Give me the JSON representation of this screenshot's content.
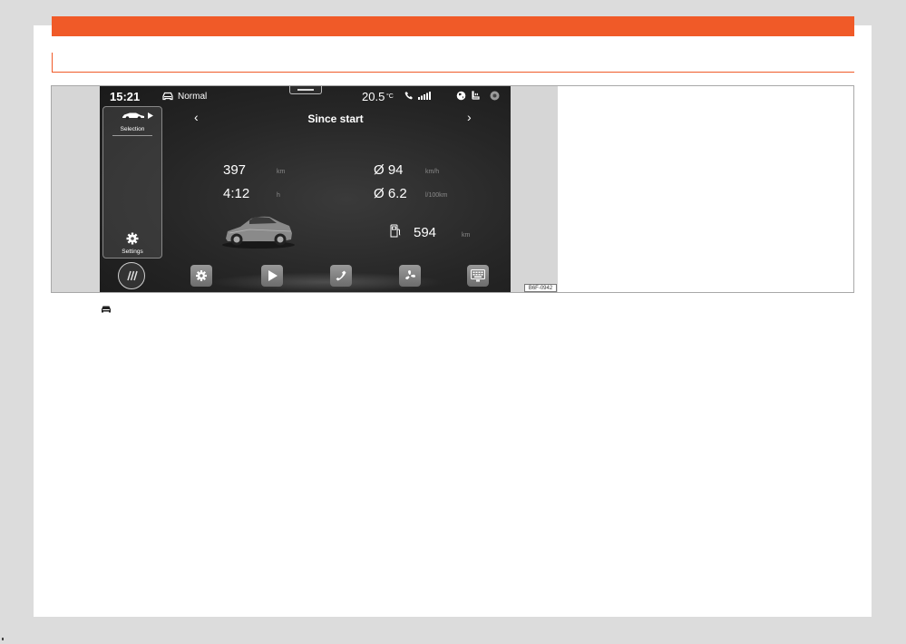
{
  "screen": {
    "time": "15:21",
    "drive_mode": "Normal",
    "outside_temp": "20.5",
    "temp_unit": "°C",
    "selection_label": "Selection",
    "settings_label": "Settings",
    "title": "Since start",
    "distance": {
      "value": "397",
      "unit": "km"
    },
    "duration": {
      "value": "4:12",
      "unit": "h"
    },
    "avg_speed": {
      "value": "Ø 94",
      "unit": "km/h"
    },
    "avg_consumption": {
      "value": "Ø 6.2",
      "unit": "l/100km"
    },
    "range": {
      "value": "594",
      "unit": "km"
    },
    "icons": {
      "drive_mode": "car-front-icon",
      "phone": "phone-icon",
      "signal": "signal-strength-icon",
      "globe": "globe-icon",
      "seat": "seat-heating-icon",
      "status_badge": "status-badge-icon",
      "fuel": "fuel-pump-icon",
      "prev": "chevron-left-icon",
      "next": "chevron-right-icon",
      "dock": [
        "menu-icon",
        "gear-icon",
        "play-icon",
        "phone-icon",
        "fan-icon",
        "keyboard-icon"
      ]
    }
  },
  "figure_code": "B6F-0942",
  "colors": {
    "accent": "#f05a28",
    "screen_bg": "#262626",
    "figure_bg": "#d6d6d6"
  }
}
